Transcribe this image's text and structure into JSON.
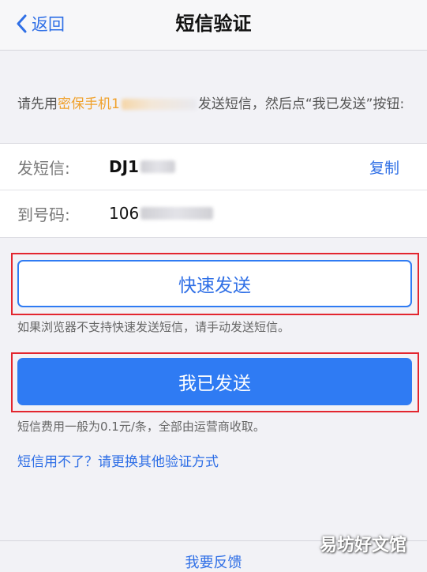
{
  "nav": {
    "back_label": "返回",
    "title": "短信验证"
  },
  "instruction": {
    "prefix": "请先用",
    "highlight": "密保手机1",
    "suffix": "发送短信，然后点“我已发送”按钮:"
  },
  "sms_info": {
    "content_label": "发短信:",
    "content_value": "DJ1",
    "copy_label": "复制",
    "target_label": "到号码:",
    "target_value": "106"
  },
  "quick_send": {
    "label": "快速发送",
    "hint": "如果浏览器不支持快速发送短信，请手动发送短信。"
  },
  "sent": {
    "label": "我已发送",
    "hint": "短信费用一般为0.1元/条，全部由运营商收取。"
  },
  "alternative_link": "短信用不了？请更换其他验证方式",
  "feedback_link": "我要反馈",
  "watermark": "易坊好文馆",
  "colors": {
    "accent": "#2f7bf3",
    "highlight": "#f0a12b",
    "annotation_box": "#e3262f"
  }
}
